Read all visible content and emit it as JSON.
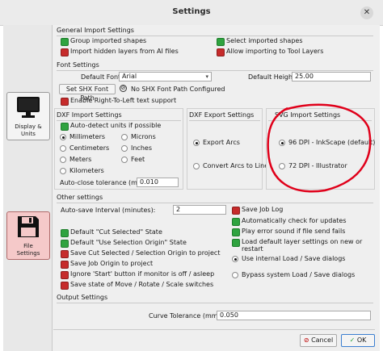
{
  "window": {
    "title": "Settings"
  },
  "nav": {
    "display": "Display &\nUnits",
    "display_l1": "Display &",
    "display_l2": "Units",
    "file_l1": "File",
    "file_l2": "Settings"
  },
  "general_import": {
    "title": "General Import Settings",
    "group_shapes": "Group imported shapes",
    "select_shapes": "Select imported shapes",
    "import_hidden": "Import hidden layers from AI files",
    "allow_tool_layers": "Allow importing to Tool Layers"
  },
  "font": {
    "title": "Font Settings",
    "default_font_label": "Default Font",
    "default_font_value": "Arial",
    "default_height_label": "Default Height",
    "default_height_value": "25.00",
    "shx_button": "Set SHX Font Path",
    "shx_status": "No SHX Font Path Configured",
    "rtl": "Enable Right-To-Left text support"
  },
  "dxf_import": {
    "title": "DXF Import Settings",
    "auto_detect": "Auto-detect units if possible",
    "millimeters": "Millimeters",
    "microns": "Microns",
    "centimeters": "Centimeters",
    "inches": "Inches",
    "meters": "Meters",
    "feet": "Feet",
    "kilometers": "Kilometers",
    "tolerance_label": "Auto-close tolerance (mm)",
    "tolerance_value": "0.010"
  },
  "dxf_export": {
    "title": "DXF Export Settings",
    "export_arcs": "Export Arcs",
    "convert_arcs": "Convert Arcs to Lines"
  },
  "svg_import": {
    "title": "SVG Import Settings",
    "dpi96": "96 DPI - InkScape (default)",
    "dpi72": "72 DPI - Illustrator"
  },
  "other": {
    "title": "Other settings",
    "autosave_label": "Auto-save Interval (minutes):",
    "autosave_value": "2",
    "save_job_log": "Save Job Log",
    "auto_check_updates": "Automatically check for updates",
    "play_error_sound": "Play error sound if file send fails",
    "load_default_layer": "Load default layer settings on new or restart",
    "default_cut_selected": "Default \"Cut Selected\" State",
    "default_use_selection": "Default \"Use Selection Origin\" State",
    "save_cut_selected": "Save Cut Selected / Selection Origin to project",
    "save_job_origin": "Save Job Origin to project",
    "ignore_start": "Ignore 'Start' button if monitor is off / asleep",
    "save_state_move": "Save state of Move / Rotate / Scale switches",
    "use_internal_load": "Use internal Load / Save dialogs",
    "bypass_system_load": "Bypass system Load / Save dialogs"
  },
  "output": {
    "title": "Output Settings",
    "curve_tol_label": "Curve Tolerance (mm)",
    "curve_tol_value": "0.050"
  },
  "footer": {
    "cancel": "Cancel",
    "ok": "OK"
  },
  "colors": {
    "checked": "#2fa33f",
    "unchecked": "#c62b2b",
    "annotation": "#e0001a"
  },
  "icons": {
    "display": "monitor-icon",
    "file": "floppy-disk-icon",
    "close": "close-icon",
    "cancel": "cancel-icon",
    "ok": "ok-icon"
  }
}
